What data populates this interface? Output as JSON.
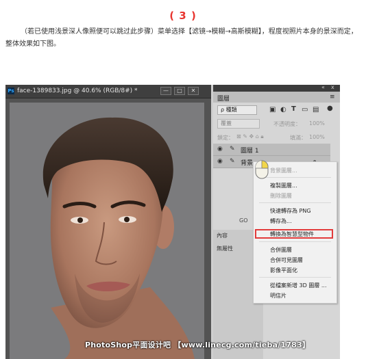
{
  "step": "( 3 )",
  "intro": "（若已使用浅景深人像照便可以跳过此步骤）菜单选择【滤镜→模糊→高斯模糊】，程度视照片本身的景深而定，整体效果如下图。",
  "document": {
    "ps_logo": "Ps",
    "title": "face-1389833.jpg @ 40.6% (RGB/8#) *",
    "minimize": "—",
    "restore": "□",
    "close": "✕"
  },
  "layers_panel": {
    "collapse": "«",
    "close": "x",
    "tab": "圖層",
    "menu": "≡",
    "kind": "ρ 種類",
    "blend": "覆蓋",
    "opacity_label": "不透明度：",
    "opacity": "100%",
    "lock_label": "鎖定：",
    "fill_label": "填滿：",
    "fill": "100%",
    "layers": [
      {
        "name": "圖層 1"
      },
      {
        "name": "背景"
      }
    ],
    "footer_link": "GO",
    "footer_fx": "fx"
  },
  "properties": {
    "tab": "內容",
    "value": "無屬性"
  },
  "context_menu": {
    "items": [
      {
        "label": "背景圖層...",
        "enabled": false
      },
      {
        "label": "複製圖層...",
        "enabled": true
      },
      {
        "label": "刪除圖層",
        "enabled": false
      },
      {
        "label": "快速轉存為 PNG",
        "enabled": true
      },
      {
        "label": "轉存為...",
        "enabled": true
      },
      {
        "label": "轉換為智慧型物件",
        "enabled": true,
        "highlighted": true
      },
      {
        "label": "合併圖層",
        "enabled": true
      },
      {
        "label": "合併可見圖層",
        "enabled": true
      },
      {
        "label": "影像平面化",
        "enabled": true
      },
      {
        "label": "從檔案新增 3D 圖層 ...",
        "enabled": true
      },
      {
        "label": "明信片",
        "enabled": true
      }
    ],
    "highlight_color": "#e23b3b"
  },
  "watermark": "PhotoShop平面设计吧 【www.linecg.com/tieba/1783】",
  "colors": {
    "accent_red": "#e8352f",
    "ps_dark": "#3f3f3f",
    "panel_gray": "#d6d6d6"
  }
}
